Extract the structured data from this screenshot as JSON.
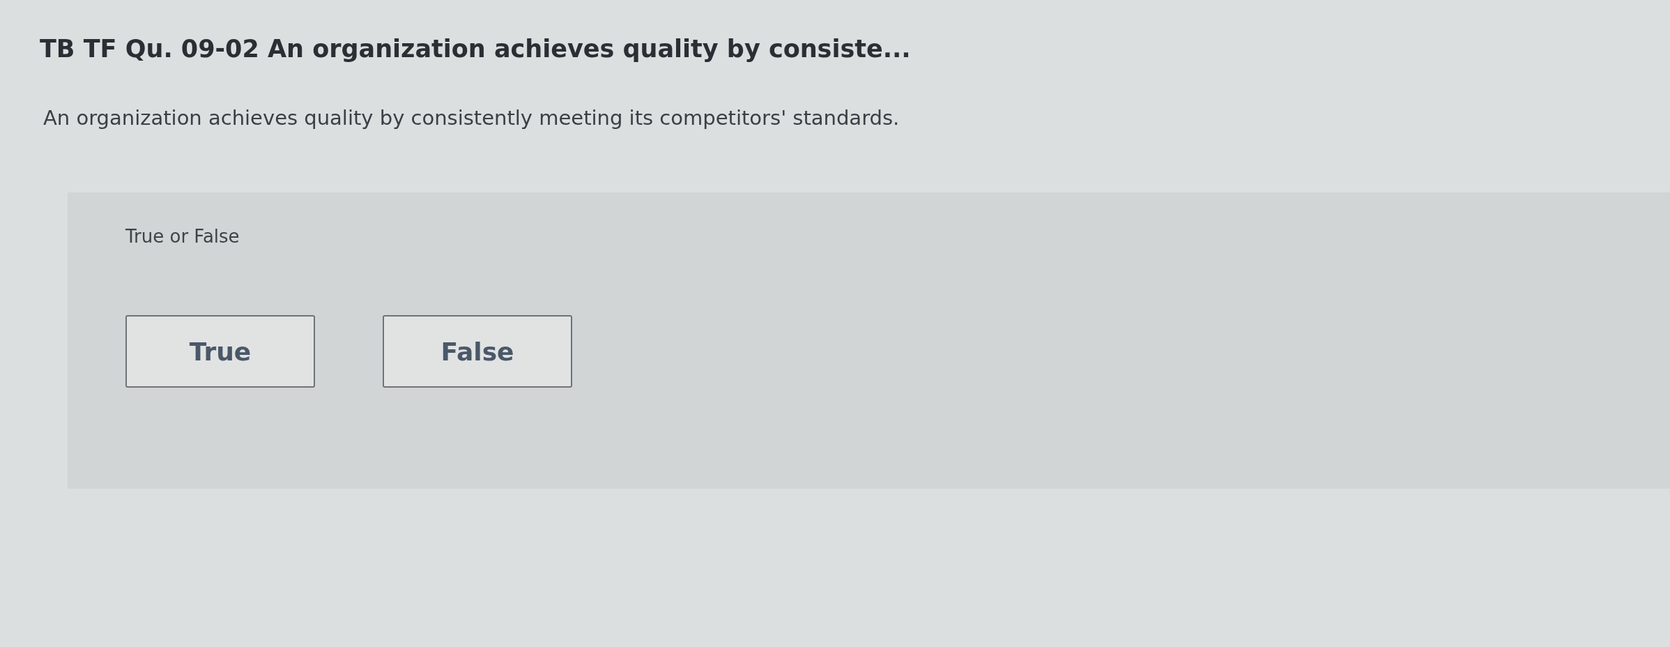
{
  "title": "TB TF Qu. 09-02 An organization achieves quality by consiste...",
  "question": "An organization achieves quality by consistently meeting its competitors' standards.",
  "answer_panel": {
    "prompt": "True or False",
    "options": [
      {
        "label": "True",
        "selected": false
      },
      {
        "label": "False",
        "selected": false
      }
    ]
  }
}
